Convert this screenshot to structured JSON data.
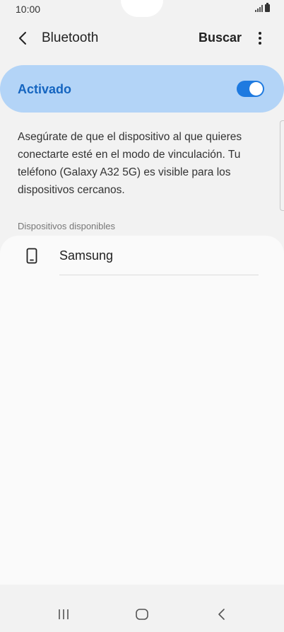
{
  "status_bar": {
    "time": "10:00"
  },
  "app_bar": {
    "title": "Bluetooth",
    "search_label": "Buscar"
  },
  "bluetooth_toggle": {
    "label": "Activado",
    "enabled": true,
    "accent_color": "#1e7ae0"
  },
  "description": "Asegúrate de que el dispositivo al que quieres conectarte esté en el modo de vinculación. Tu teléfono (Galaxy A32 5G) es visible para los dispositivos cercanos.",
  "available_devices": {
    "header": "Dispositivos disponibles",
    "items": [
      {
        "name": "Samsung",
        "icon": "phone-icon"
      }
    ]
  },
  "nav_bar": {
    "buttons": [
      "recents",
      "home",
      "back"
    ]
  }
}
